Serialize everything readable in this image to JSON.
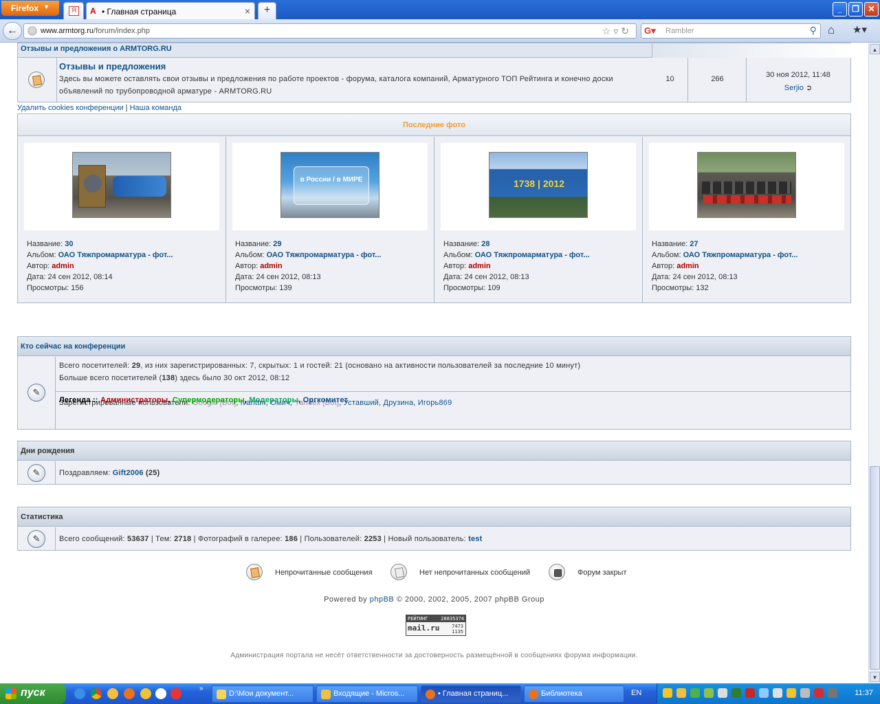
{
  "browser": {
    "app_button": "Firefox",
    "tab_title": "• Главная страница",
    "url_host": "www.armtorg.ru",
    "url_path": "/forum/index.php",
    "search_placeholder": "Rambler"
  },
  "forum": {
    "category_title": "Отзывы и предложения о ARMTORG.RU",
    "title": "Отзывы и предложения",
    "description": "Здесь вы можете оставлять свои отзывы и предложения по работе проектов - форума, каталога компаний, Арматурного ТОП Рейтинга и конечно доски объявлений по трубопроводной арматуре - ARMTORG.RU",
    "topics": "10",
    "posts": "266",
    "last_post_date": "30 ноя 2012, 11:48",
    "last_post_author": "Serjio"
  },
  "footer_links": {
    "delete_cookies": "Удалить cookies конференции",
    "separator": "|",
    "team": "Наша команда"
  },
  "photos": {
    "header": "Последние фото",
    "labels": {
      "name": "Название:",
      "album": "Альбом:",
      "author": "Автор:",
      "date": "Дата:",
      "views": "Просмотры:"
    },
    "items": [
      {
        "name": "30",
        "album": "ОАО Тяжпромарматура - фот...",
        "author": "admin",
        "date": "24 сен 2012, 08:14",
        "views": "156",
        "caption": ""
      },
      {
        "name": "29",
        "album": "ОАО Тяжпромарматура - фот...",
        "author": "admin",
        "date": "24 сен 2012, 08:13",
        "views": "139",
        "caption": "в России / в МИРЕ"
      },
      {
        "name": "28",
        "album": "ОАО Тяжпромарматура - фот...",
        "author": "admin",
        "date": "24 сен 2012, 08:13",
        "views": "109",
        "caption": "1738 | 2012"
      },
      {
        "name": "27",
        "album": "ОАО Тяжпромарматура - фот...",
        "author": "admin",
        "date": "24 сен 2012, 08:13",
        "views": "132",
        "caption": ""
      }
    ]
  },
  "online": {
    "header": "Кто сейчас на конференции",
    "line1_prefix": "Всего посетителей:",
    "line1_total": "29",
    "line1_rest": ", из них зарегистрированных: 7, скрытых: 1 и гостей: 21 (основано на активности пользователей за последние 10 минут)",
    "line2_prefix": "Больше всего посетителей (",
    "line2_max": "138",
    "line2_rest": ") здесь было 30 окт 2012, 08:12",
    "registered_label": "Зарегистрированные пользователи:",
    "users": [
      {
        "name": "Google [Bot]",
        "color": "#9E8DA7"
      },
      {
        "name": "ivanttm",
        "color": "#105289"
      },
      {
        "name": "Омич",
        "color": "#105289"
      },
      {
        "name": "Yandex [Bot]",
        "color": "#9E8DA7"
      },
      {
        "name": "Уставший",
        "color": "#105289"
      },
      {
        "name": "Друзина",
        "color": "#105289"
      },
      {
        "name": "Игорь869",
        "color": "#105289"
      }
    ],
    "legend_label": "Легенда ::",
    "legend": [
      {
        "name": "Администраторы",
        "color": "#AA0000"
      },
      {
        "name": "Супермодераторы",
        "color": "#00AA00"
      },
      {
        "name": "Модераторы",
        "color": "#00AA55"
      },
      {
        "name": "Оргкомитет",
        "color": "#0A4C8A"
      }
    ]
  },
  "birthdays": {
    "header": "Дни рождения",
    "prefix": "Поздравляем:",
    "user": "Gift2006",
    "age": "(25)"
  },
  "stats": {
    "header": "Статистика",
    "posts_label": "Всего сообщений:",
    "posts": "53637",
    "topics_label": "Тем:",
    "topics": "2718",
    "photos_label": "Фотографий в галерее:",
    "photos": "186",
    "users_label": "Пользователей:",
    "users": "2253",
    "newest_label": "Новый пользователь:",
    "newest": "test"
  },
  "icon_legend": {
    "unread": "Непрочитанные сообщения",
    "no_unread": "Нет непрочитанных сообщений",
    "locked": "Форум закрыт"
  },
  "powered": {
    "prefix": "Powered by",
    "link": "phpBB",
    "suffix": "© 2000, 2002, 2005, 2007 phpBB Group"
  },
  "counter": {
    "label": "РЕЙТИНГ",
    "total": "28835374",
    "logo": "mail.ru",
    "today": "7473",
    "hosts": "1135"
  },
  "disclaimer": "Администрация портала не несёт ответственности за достоверность размещённой в сообщениях форума информации.",
  "taskbar": {
    "start": "пуск",
    "tasks": [
      "D:\\Мои документ...",
      "Входящие - Micros...",
      "• Главная страниц...",
      "Библиотека"
    ],
    "lang": "EN",
    "clock": "11:37"
  }
}
